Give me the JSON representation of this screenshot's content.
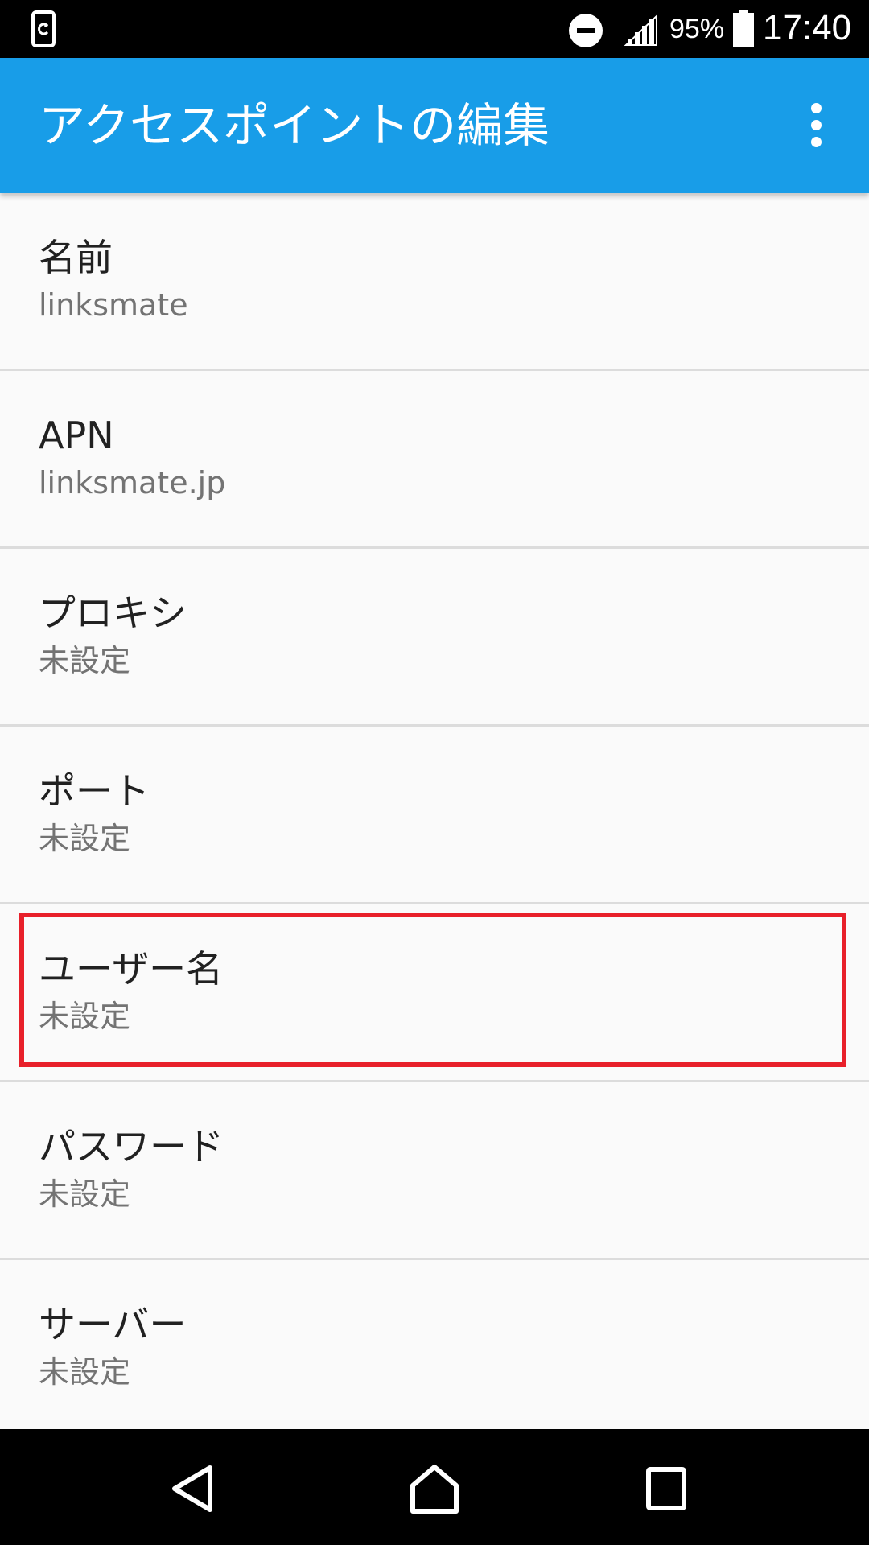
{
  "status_bar": {
    "battery_percent": "95%",
    "time": "17:40",
    "icons": [
      "screen-rotation-icon",
      "do-not-disturb-icon",
      "signal-icon",
      "battery-icon"
    ]
  },
  "app_bar": {
    "title": "アクセスポイントの編集",
    "menu_icon": "overflow-menu-icon",
    "background_color": "#189de8"
  },
  "preferences": [
    {
      "title": "名前",
      "summary": "linksmate"
    },
    {
      "title": "APN",
      "summary": "linksmate.jp"
    },
    {
      "title": "プロキシ",
      "summary": "未設定"
    },
    {
      "title": "ポート",
      "summary": "未設定"
    },
    {
      "title": "ユーザー名",
      "summary": "未設定"
    },
    {
      "title": "パスワード",
      "summary": "未設定"
    },
    {
      "title": "サーバー",
      "summary": "未設定"
    }
  ],
  "highlight_color": "#e8202a",
  "nav_bar": {
    "icons": [
      "back-icon",
      "home-icon",
      "recents-icon"
    ]
  }
}
